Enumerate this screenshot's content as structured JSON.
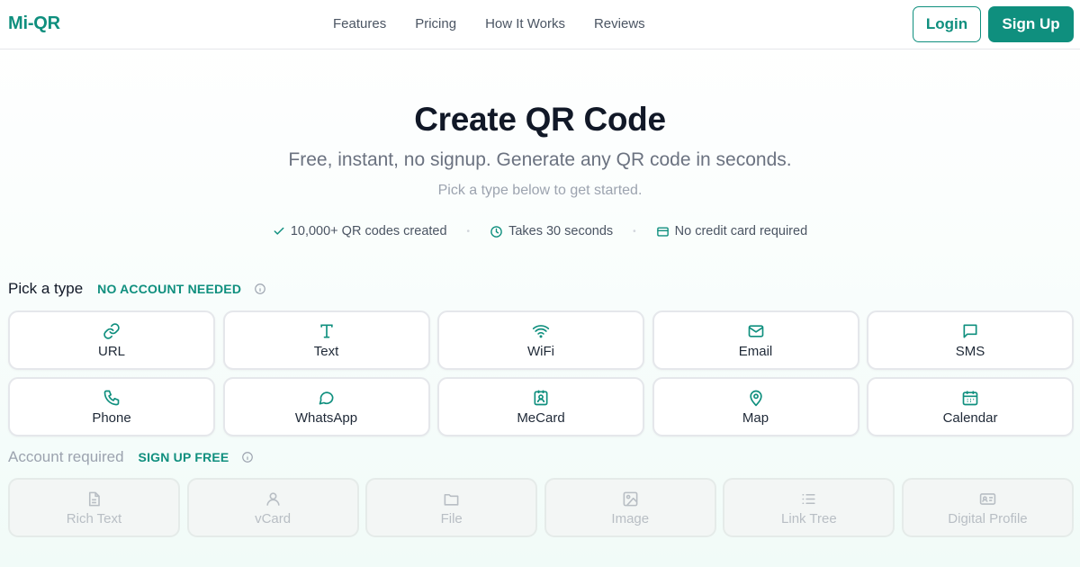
{
  "header": {
    "logo": "Mi-QR",
    "nav": [
      "Features",
      "Pricing",
      "How It Works",
      "Reviews"
    ],
    "login_label": "Login",
    "signup_label": "Sign Up"
  },
  "hero": {
    "title": "Create QR Code",
    "subtitle": "Free, instant, no signup. Generate any QR code in seconds.",
    "hint": "Pick a type below to get started.",
    "stats": [
      {
        "icon": "check-icon",
        "text": "10,000+ QR codes created"
      },
      {
        "icon": "clock-icon",
        "text": "Takes 30 seconds"
      },
      {
        "icon": "credit-card-icon",
        "text": "No credit card required"
      }
    ]
  },
  "free_section": {
    "title": "Pick a type",
    "badge": "NO ACCOUNT NEEDED",
    "types": [
      {
        "label": "URL",
        "icon": "link-icon"
      },
      {
        "label": "Text",
        "icon": "text-icon"
      },
      {
        "label": "WiFi",
        "icon": "wifi-icon"
      },
      {
        "label": "Email",
        "icon": "mail-icon"
      },
      {
        "label": "SMS",
        "icon": "message-icon"
      },
      {
        "label": "Phone",
        "icon": "phone-icon"
      },
      {
        "label": "WhatsApp",
        "icon": "chat-bubble-icon"
      },
      {
        "label": "MeCard",
        "icon": "contact-card-icon"
      },
      {
        "label": "Map",
        "icon": "map-pin-icon"
      },
      {
        "label": "Calendar",
        "icon": "calendar-icon"
      }
    ]
  },
  "account_section": {
    "title": "Account required",
    "badge": "SIGN UP FREE",
    "types": [
      {
        "label": "Rich Text",
        "icon": "document-icon"
      },
      {
        "label": "vCard",
        "icon": "user-icon"
      },
      {
        "label": "File",
        "icon": "folder-icon"
      },
      {
        "label": "Image",
        "icon": "image-icon"
      },
      {
        "label": "Link Tree",
        "icon": "list-icon"
      },
      {
        "label": "Digital Profile",
        "icon": "id-card-icon"
      }
    ]
  },
  "colors": {
    "brand": "#0f8f7e",
    "text": "#111827",
    "muted": "#9ca3af",
    "locked_bg": "#f3f6f5"
  }
}
